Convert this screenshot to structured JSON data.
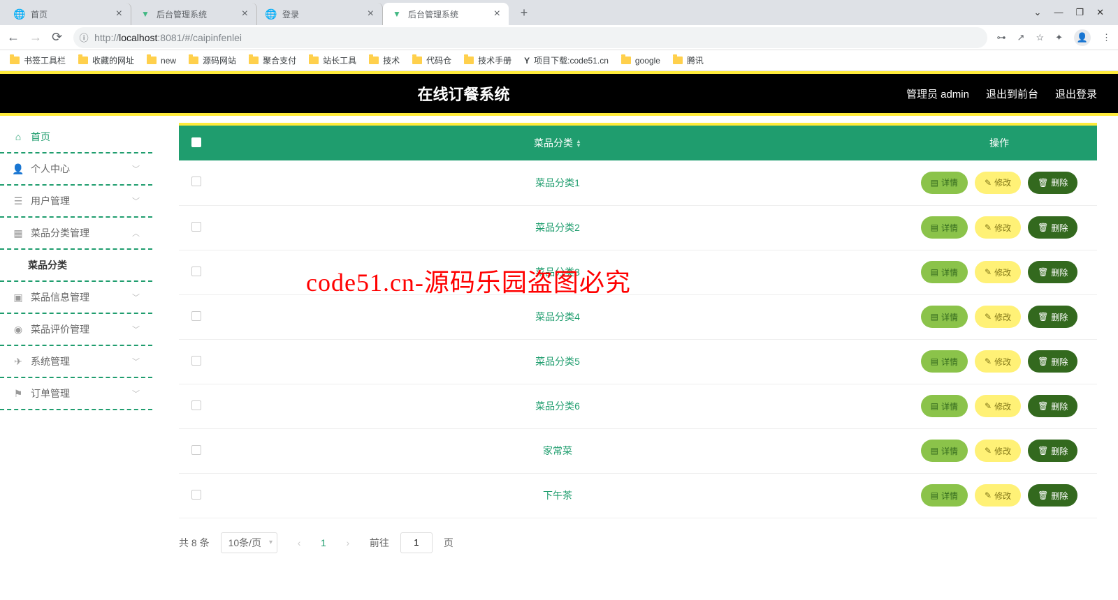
{
  "browser": {
    "tabs": [
      {
        "title": "首页",
        "favicon": "globe"
      },
      {
        "title": "后台管理系统",
        "favicon": "vue"
      },
      {
        "title": "登录",
        "favicon": "globe"
      },
      {
        "title": "后台管理系统",
        "favicon": "vue",
        "active": true
      }
    ],
    "url_prefix": "http://",
    "url_host": "localhost",
    "url_rest": ":8081/#/caipinfenlei",
    "bookmarks": [
      "书签工具栏",
      "收藏的网址",
      "new",
      "源码网站",
      "聚合支付",
      "站长工具",
      "技术",
      "代码仓",
      "技术手册",
      "项目下载:code51.cn",
      "google",
      "腾讯"
    ]
  },
  "header": {
    "title": "在线订餐系统",
    "admin": "管理员 admin",
    "front": "退出到前台",
    "logout": "退出登录"
  },
  "sidebar": {
    "home": "首页",
    "items": [
      {
        "label": "个人中心",
        "icon": "user",
        "expand": "down"
      },
      {
        "label": "用户管理",
        "icon": "sliders",
        "expand": "down"
      },
      {
        "label": "菜品分类管理",
        "icon": "category",
        "expand": "up",
        "sub": "菜品分类"
      },
      {
        "label": "菜品信息管理",
        "icon": "info",
        "expand": "down"
      },
      {
        "label": "菜品评价管理",
        "icon": "rating",
        "expand": "down"
      },
      {
        "label": "系统管理",
        "icon": "system",
        "expand": "down"
      },
      {
        "label": "订单管理",
        "icon": "flag",
        "expand": "down"
      }
    ]
  },
  "table": {
    "col_category": "菜品分类",
    "col_action": "操作",
    "rows": [
      "菜品分类1",
      "菜品分类2",
      "菜品分类3",
      "菜品分类4",
      "菜品分类5",
      "菜品分类6",
      "家常菜",
      "下午茶"
    ],
    "btn_detail": "详情",
    "btn_edit": "修改",
    "btn_delete": "删除"
  },
  "pagination": {
    "total": "共 8 条",
    "per_page": "10条/页",
    "current": "1",
    "goto_pre": "前往",
    "goto_input": "1",
    "goto_post": "页"
  },
  "watermark": "code51.cn-源码乐园盗图必究"
}
